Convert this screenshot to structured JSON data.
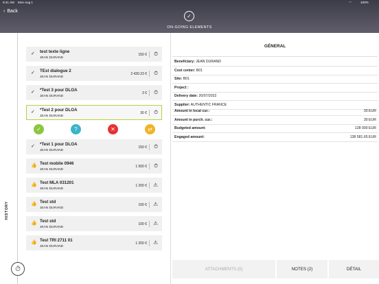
{
  "status_bar": {
    "time": "9:41 AM",
    "date": "Mon Aug 1",
    "battery": "100%"
  },
  "header": {
    "back_label": "Back",
    "title": "ON-GOING ELEMENTS"
  },
  "sidebar": {
    "history_label": "HISTORY"
  },
  "elements": [
    {
      "title": "test texte ligne",
      "person": "JEAN DURAND",
      "amount": "150 €",
      "status_icon": "timer-icon",
      "lead_icon": "check-icon"
    },
    {
      "title": "TEst dialogue 2",
      "person": "JEAN DURAND",
      "amount": "2 430.23 €",
      "status_icon": "timer-icon",
      "lead_icon": "check-icon"
    },
    {
      "title": "*Test 3 pour DLOA",
      "person": "JEAN DURAND",
      "amount": "3 €",
      "status_icon": "timer-icon",
      "lead_icon": "check-icon"
    },
    {
      "title": "*Test 2 pour DLOA",
      "person": "JEAN DURAND",
      "amount": "30 €",
      "status_icon": "timer-icon",
      "lead_icon": "check-icon",
      "selected": true
    },
    {
      "title": "*Test 1 pour DLOA",
      "person": "JEAN DURAND",
      "amount": "150 €",
      "status_icon": "timer-icon",
      "lead_icon": "check-icon"
    },
    {
      "title": "Test mobile 0946",
      "person": "JEAN DURAND",
      "amount": "1 500 €",
      "status_icon": "timer-icon",
      "lead_icon": "thumbs-up-icon"
    },
    {
      "title": "Test MLA 031201",
      "person": "JEAN DURAND",
      "amount": "1 200 €",
      "status_icon": "warning-icon",
      "lead_icon": "thumbs-up-icon"
    },
    {
      "title": "Test std",
      "person": "JEAN DURAND",
      "amount": "100 €",
      "status_icon": "warning-icon",
      "lead_icon": "thumbs-up-icon"
    },
    {
      "title": "Test std",
      "person": "JEAN DURAND",
      "amount": "100 €",
      "status_icon": "warning-icon",
      "lead_icon": "thumbs-up-icon"
    },
    {
      "title": "Test TRI 2711 01",
      "person": "JEAN DURAND",
      "amount": "1 200 €",
      "status_icon": "warning-icon",
      "lead_icon": "thumbs-up-icon"
    }
  ],
  "actions": [
    {
      "name": "approve",
      "icon": "checkmark-icon",
      "color": "#8cc63f"
    },
    {
      "name": "question",
      "icon": "question-icon",
      "color": "#3cb4c8"
    },
    {
      "name": "reject",
      "icon": "cross-icon",
      "color": "#e63232"
    },
    {
      "name": "transfer",
      "icon": "shuffle-icon",
      "color": "#f0b428"
    }
  ],
  "general": {
    "title": "GÉNERAL",
    "fields": [
      {
        "label": "Beneficiary:",
        "value": "JEAN DURAND"
      },
      {
        "label": "Cost center:",
        "value": "B01"
      },
      {
        "label": "Site:",
        "value": "B01"
      },
      {
        "label": "Project :",
        "value": ""
      },
      {
        "label": "Delivery date:",
        "value": "20/07/2022"
      },
      {
        "label": "Supplier:",
        "value": "AUTHENTIC FRANCE"
      }
    ],
    "amounts": [
      {
        "label": "Amount in local cur.:",
        "value": "30 EUR"
      },
      {
        "label": "Amount in purch. cur.:",
        "value": "30 EUR"
      },
      {
        "label": "Budgeted amount:",
        "value": "128 000 EUR"
      },
      {
        "label": "Engaged amount:",
        "value": "138 581.65 EUR"
      }
    ]
  },
  "tabs": {
    "attachments": "ATTACHMENTS (0)",
    "notes": "NOTES (2)",
    "detail": "DÉTAIL"
  },
  "colors": {
    "header_top": "#3c3c48",
    "selected_border": "#b7d23a"
  }
}
